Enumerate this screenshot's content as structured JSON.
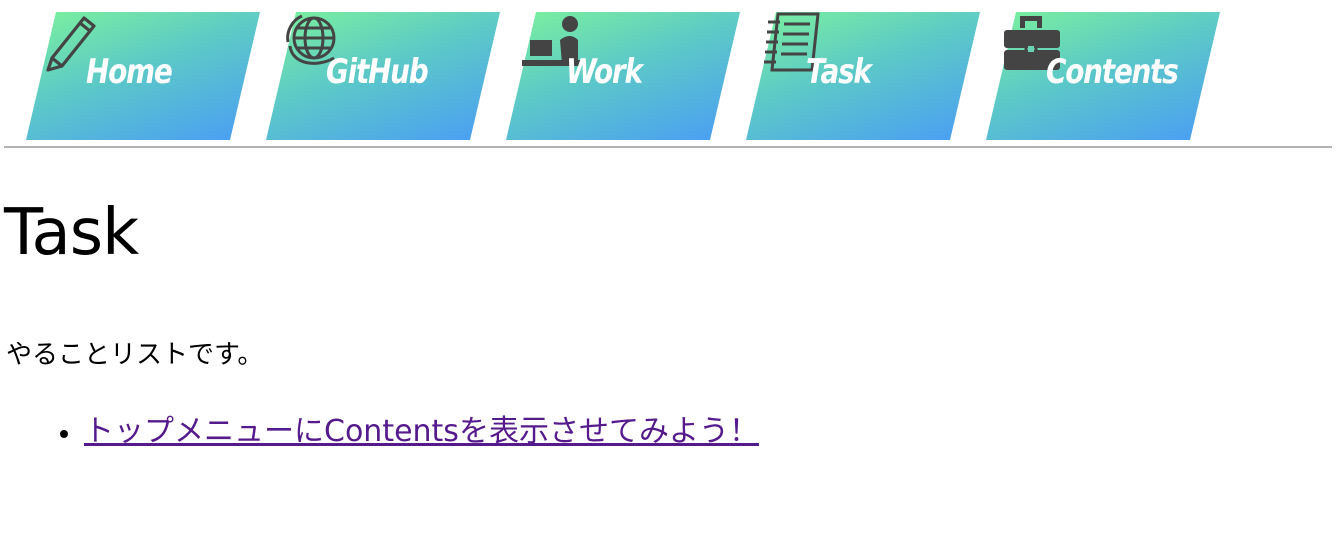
{
  "nav": {
    "items": [
      {
        "label": "Home",
        "icon": "pencil-icon"
      },
      {
        "label": "GitHub",
        "icon": "globe-icon"
      },
      {
        "label": "Work",
        "icon": "person-at-desk-icon"
      },
      {
        "label": "Task",
        "icon": "notebook-icon"
      },
      {
        "label": "Contents",
        "icon": "toolbox-icon"
      }
    ],
    "gradient_start": "#7cf29c",
    "gradient_end": "#4a9cf6",
    "icon_color": "#444444"
  },
  "page": {
    "title": "Task",
    "intro": "やることリストです。"
  },
  "tasks": [
    {
      "text": "トップメニューにContentsを表示させてみよう！"
    }
  ],
  "colors": {
    "visited_link": "#551a8b"
  }
}
